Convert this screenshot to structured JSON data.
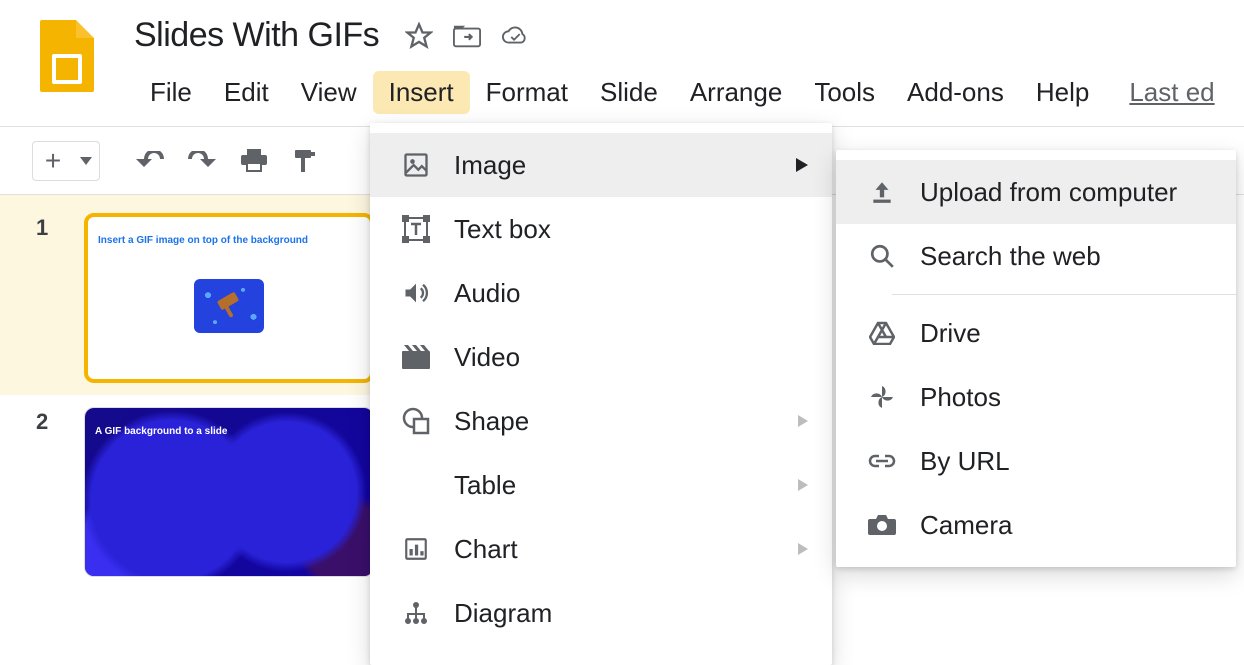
{
  "doc": {
    "title": "Slides With GIFs"
  },
  "menubar": {
    "items": [
      {
        "label": "File"
      },
      {
        "label": "Edit"
      },
      {
        "label": "View"
      },
      {
        "label": "Insert"
      },
      {
        "label": "Format"
      },
      {
        "label": "Slide"
      },
      {
        "label": "Arrange"
      },
      {
        "label": "Tools"
      },
      {
        "label": "Add-ons"
      },
      {
        "label": "Help"
      }
    ],
    "last_edit": "Last ed"
  },
  "slides": [
    {
      "number": "1",
      "title": "Insert a GIF image on top of the background"
    },
    {
      "number": "2",
      "title": "A GIF background to a slide"
    }
  ],
  "insert_menu": {
    "items": [
      {
        "label": "Image",
        "has_submenu": true
      },
      {
        "label": "Text box",
        "has_submenu": false
      },
      {
        "label": "Audio",
        "has_submenu": false
      },
      {
        "label": "Video",
        "has_submenu": false
      },
      {
        "label": "Shape",
        "has_submenu": true
      },
      {
        "label": "Table",
        "has_submenu": true
      },
      {
        "label": "Chart",
        "has_submenu": true
      },
      {
        "label": "Diagram",
        "has_submenu": false
      }
    ]
  },
  "image_submenu": {
    "items": [
      {
        "label": "Upload from computer"
      },
      {
        "label": "Search the web"
      },
      {
        "label": "Drive"
      },
      {
        "label": "Photos"
      },
      {
        "label": "By URL"
      },
      {
        "label": "Camera"
      }
    ]
  },
  "colors": {
    "brand_yellow": "#f4b400",
    "menu_highlight": "#fce8b2"
  }
}
